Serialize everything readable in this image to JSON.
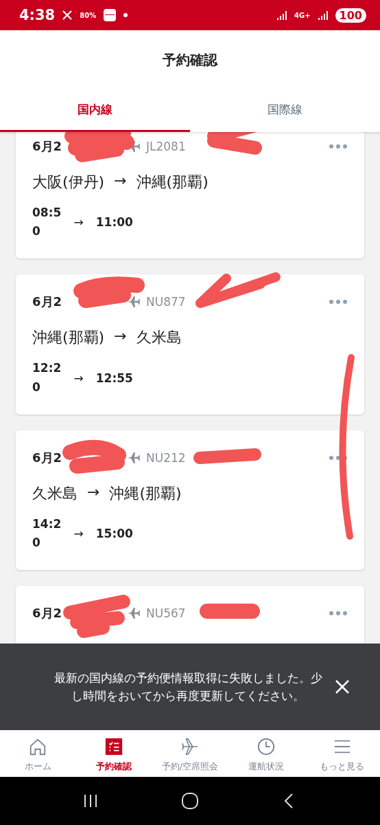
{
  "status_bar": {
    "time": "4:38",
    "weather": "80%",
    "battery": "100",
    "network": "4G+"
  },
  "header": {
    "title": "予約確認"
  },
  "tabs": [
    {
      "label": "国内線",
      "selected": true
    },
    {
      "label": "国際線",
      "selected": false
    }
  ],
  "reservations": [
    {
      "date": "6月2",
      "flight": "JL2081",
      "route_from": "大阪(伊丹)",
      "route_arrow": "→",
      "route_to": "沖縄(那覇)",
      "departure": "08:50",
      "time_arrow": "→",
      "arrival": "11:00"
    },
    {
      "date": "6月2",
      "flight": "NU877",
      "route_from": "沖縄(那覇)",
      "route_arrow": "→",
      "route_to": "久米島",
      "departure": "12:20",
      "time_arrow": "→",
      "arrival": "12:55"
    },
    {
      "date": "6月2",
      "flight": "NU212",
      "route_from": "久米島",
      "route_arrow": "→",
      "route_to": "沖縄(那覇)",
      "departure": "14:20",
      "time_arrow": "→",
      "arrival": "15:00"
    },
    {
      "date": "6月2",
      "flight": "NU567"
    }
  ],
  "snackbar": {
    "message": "最新の国内線の予約便情報取得に失敗しました。少し時間をおいてから再度更新してください。"
  },
  "bottom_nav": [
    {
      "kind": "home",
      "label": "ホーム",
      "selected": false
    },
    {
      "kind": "list",
      "label": "予約確認",
      "selected": true
    },
    {
      "kind": "plane",
      "label": "予約/空席照会",
      "selected": false
    },
    {
      "kind": "clock",
      "label": "運航状況",
      "selected": false
    },
    {
      "kind": "menu",
      "label": "もっと見る",
      "selected": false
    }
  ]
}
